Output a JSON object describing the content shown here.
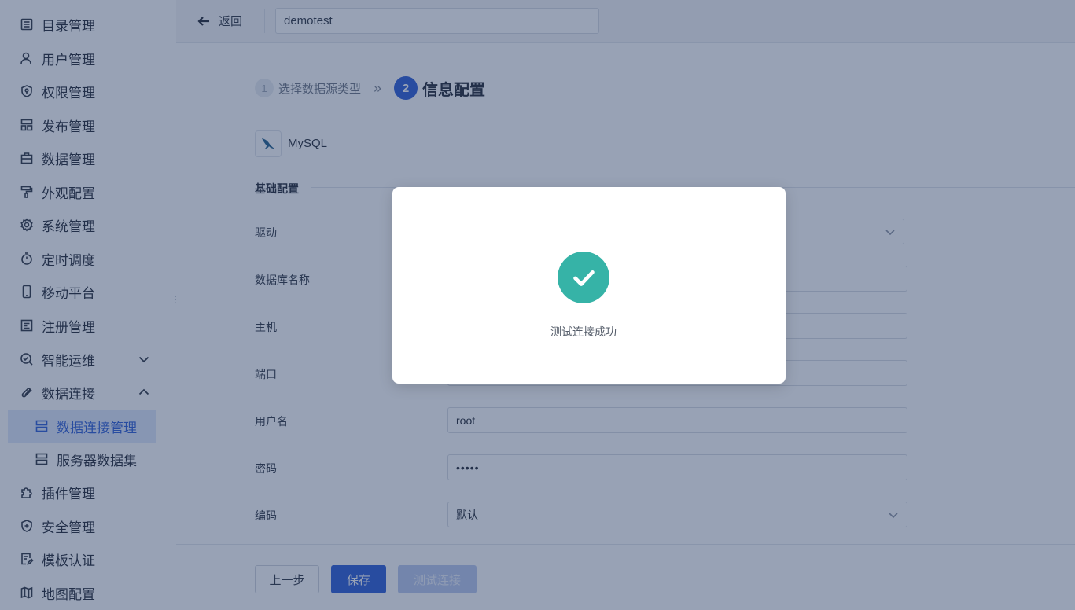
{
  "sidebar": {
    "items": [
      {
        "label": "目录管理",
        "icon": "catalog-icon"
      },
      {
        "label": "用户管理",
        "icon": "user-icon"
      },
      {
        "label": "权限管理",
        "icon": "shield-key-icon"
      },
      {
        "label": "发布管理",
        "icon": "layout-icon"
      },
      {
        "label": "数据管理",
        "icon": "briefcase-icon"
      },
      {
        "label": "外观配置",
        "icon": "paint-roller-icon"
      },
      {
        "label": "系统管理",
        "icon": "gear-icon"
      },
      {
        "label": "定时调度",
        "icon": "timer-icon"
      },
      {
        "label": "移动平台",
        "icon": "mobile-icon"
      },
      {
        "label": "注册管理",
        "icon": "register-icon"
      },
      {
        "label": "智能运维",
        "icon": "ops-icon"
      },
      {
        "label": "数据连接",
        "icon": "link-icon"
      },
      {
        "label": "数据连接管理",
        "icon": "server-icon"
      },
      {
        "label": "服务器数据集",
        "icon": "server-icon"
      },
      {
        "label": "插件管理",
        "icon": "puzzle-icon"
      },
      {
        "label": "安全管理",
        "icon": "shield-plus-icon"
      },
      {
        "label": "模板认证",
        "icon": "doc-edit-icon"
      },
      {
        "label": "地图配置",
        "icon": "map-icon"
      }
    ]
  },
  "topbar": {
    "back_label": "返回",
    "name_value": "demotest"
  },
  "steps": {
    "step1_num": "1",
    "step1_label": "选择数据源类型",
    "arrow": "»",
    "step2_num": "2",
    "step2_label": "信息配置"
  },
  "datasource": {
    "name": "MySQL"
  },
  "form": {
    "section_title": "基础配置",
    "fields": [
      {
        "label": "驱动",
        "value": ""
      },
      {
        "label": "数据库名称",
        "value": ""
      },
      {
        "label": "主机",
        "value": ""
      },
      {
        "label": "端口",
        "value": ""
      },
      {
        "label": "用户名",
        "value": "root"
      },
      {
        "label": "密码",
        "value": "•••••"
      },
      {
        "label": "编码",
        "value": "默认"
      }
    ]
  },
  "footer": {
    "prev_label": "上一步",
    "save_label": "保存",
    "test_label": "测试连接"
  },
  "modal": {
    "message": "测试连接成功"
  },
  "colors": {
    "primary": "#2a5bd7",
    "success": "#36b3a7"
  }
}
